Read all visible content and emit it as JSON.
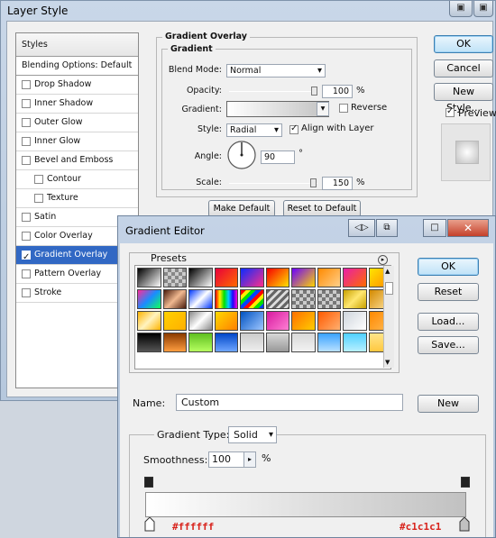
{
  "layer_style": {
    "title": "Layer Style",
    "styles_header": "Styles",
    "blending_options": "Blending Options: Default",
    "items": [
      {
        "label": "Drop Shadow",
        "checked": false,
        "sub": false,
        "selected": false
      },
      {
        "label": "Inner Shadow",
        "checked": false,
        "sub": false,
        "selected": false
      },
      {
        "label": "Outer Glow",
        "checked": false,
        "sub": false,
        "selected": false
      },
      {
        "label": "Inner Glow",
        "checked": false,
        "sub": false,
        "selected": false
      },
      {
        "label": "Bevel and Emboss",
        "checked": false,
        "sub": false,
        "selected": false
      },
      {
        "label": "Contour",
        "checked": false,
        "sub": true,
        "selected": false
      },
      {
        "label": "Texture",
        "checked": false,
        "sub": true,
        "selected": false
      },
      {
        "label": "Satin",
        "checked": false,
        "sub": false,
        "selected": false
      },
      {
        "label": "Color Overlay",
        "checked": false,
        "sub": false,
        "selected": false
      },
      {
        "label": "Gradient Overlay",
        "checked": true,
        "sub": false,
        "selected": true
      },
      {
        "label": "Pattern Overlay",
        "checked": false,
        "sub": false,
        "selected": false
      },
      {
        "label": "Stroke",
        "checked": false,
        "sub": false,
        "selected": false
      }
    ],
    "section_title": "Gradient Overlay",
    "group_title": "Gradient",
    "blend_mode_label": "Blend Mode:",
    "blend_mode_value": "Normal",
    "opacity_label": "Opacity:",
    "opacity_value": "100",
    "opacity_unit": "%",
    "gradient_label": "Gradient:",
    "reverse_label": "Reverse",
    "style_label": "Style:",
    "style_value": "Radial",
    "align_label": "Align with Layer",
    "angle_label": "Angle:",
    "angle_value": "90",
    "angle_unit": "°",
    "scale_label": "Scale:",
    "scale_value": "150",
    "scale_unit": "%",
    "make_default": "Make Default",
    "reset_default": "Reset to Default",
    "ok": "OK",
    "cancel": "Cancel",
    "new_style": "New Style...",
    "preview": "Preview",
    "preview_checked": true,
    "opacity_slider": 1.0,
    "scale_slider": 0.97
  },
  "gradient_editor": {
    "title": "Gradient Editor",
    "presets_label": "Presets",
    "ok": "OK",
    "reset": "Reset",
    "load": "Load...",
    "save": "Save...",
    "name_label": "Name:",
    "name_value": "Custom",
    "new": "New",
    "gradient_type_label": "Gradient Type:",
    "gradient_type_value": "Solid",
    "smoothness_label": "Smoothness:",
    "smoothness_value": "100",
    "smoothness_unit": "%",
    "stop_left_color": "#ffffff",
    "stop_right_color": "#c1c1c1",
    "preset_swatches": [
      "linear-gradient(135deg,#000,#fff)",
      "repeating-conic-gradient(#888 0 25%,#ccc 0 50%) 0 0/8px 8px",
      "linear-gradient(135deg,#000,#fff)",
      "linear-gradient(135deg,#e8003a,#ff6a00)",
      "linear-gradient(135deg,#0a2cff,#ff2e8a)",
      "linear-gradient(135deg,#f70000,#ffe000)",
      "linear-gradient(135deg,#6a00ff,#ffd400)",
      "linear-gradient(135deg,#ff8a00,#ffd08a)",
      "linear-gradient(135deg,#e91ea8,#ff6b00)",
      "linear-gradient(135deg,#ffe400,#ff8a00)",
      "linear-gradient(135deg,#ff2b9a,#1a8cff,#11ff5a)",
      "linear-gradient(135deg,#4a1c0c,#f0b890,#4a1c0c)",
      "linear-gradient(135deg,#0037ff,#fff,#0037ff)",
      "linear-gradient(90deg,#ff0000,#ffee00,#00e000,#00d0ff,#2000ff,#ff00d0)",
      "repeating-linear-gradient(135deg,#ff0000 0 4px,#ffee00 4px 8px,#00e000 8px 12px,#0040ff 12px 16px)",
      "repeating-linear-gradient(135deg,#666 0 3px,#ddd 3px 6px)",
      "repeating-conic-gradient(#777 0 25%,#ccc 0 50%) 0 0/8px 8px",
      "repeating-conic-gradient(#777 0 25%,#ccc 0 50%) 0 0/8px 8px",
      "linear-gradient(135deg,#c8a000,#ffe770,#c8a000)",
      "linear-gradient(135deg,#d38a00,#ffe3a0)",
      "linear-gradient(135deg,#ffb400,#fff3c0,#ffb400)",
      "linear-gradient(135deg,#ffd000,#ffb000)",
      "linear-gradient(135deg,#888,#fff,#888)",
      "linear-gradient(135deg,#ffd800,#ff8000)",
      "linear-gradient(135deg,#0052c2,#9fc7ff)",
      "linear-gradient(135deg,#d81aa0,#ff7fd3)",
      "linear-gradient(135deg,#ff7000,#ffcc00)",
      "linear-gradient(135deg,#ff5a00,#ffb070)",
      "linear-gradient(135deg,#cfd6dd,#ffffff)",
      "linear-gradient(135deg,#ff8800,#ffbb55)",
      "linear-gradient(180deg,#000,#555)",
      "linear-gradient(180deg,#8a3a00,#ff9d40)",
      "linear-gradient(180deg,#5fbf20,#b6ff60)",
      "linear-gradient(180deg,#0046c8,#6ea5ff)",
      "linear-gradient(180deg,#ccc,#eee)",
      "linear-gradient(180deg,#d8d8d8,#999)",
      "linear-gradient(180deg,#d8d8d8,#f2f2f2)",
      "linear-gradient(180deg,#39a2ff,#b9e1ff)",
      "linear-gradient(180deg,#4fd0ff,#b8f0ff)",
      "linear-gradient(180deg,#ffe58a,#ffc840)"
    ]
  }
}
